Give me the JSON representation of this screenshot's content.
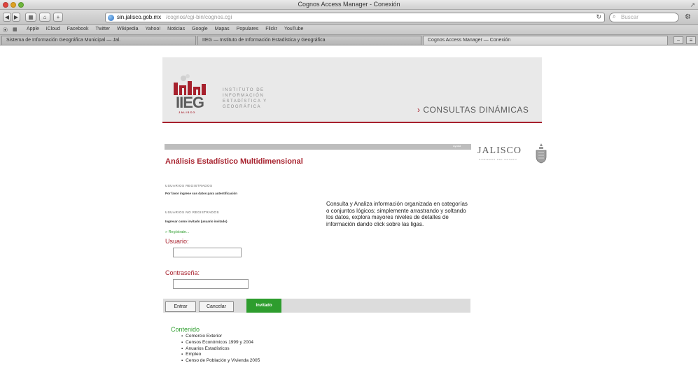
{
  "window": {
    "title": "Cognos Access Manager - Conexión",
    "address_host": "sin.jalisco.gob.mx",
    "address_path": "/cognos/cgi-bin/cognos.cgi",
    "search_placeholder": "Buscar"
  },
  "bookmarks": {
    "items": [
      "Apple",
      "iCloud",
      "Facebook",
      "Twitter",
      "Wikipedia",
      "Yahoo!",
      "Noticias",
      "Google",
      "Mapas",
      "Populares",
      "Flickr",
      "YouTube"
    ]
  },
  "tabs": [
    {
      "label": "Sistema de Información Geográfica Municipal — Jal.",
      "active": false
    },
    {
      "label": "IIEG — Instituto de Información Estadística y Geográfica",
      "active": false
    },
    {
      "label": "Cognos Access Manager — Conexión",
      "active": true
    }
  ],
  "banner": {
    "logo_word": "IIEG",
    "logo_sub": "JALISCO",
    "institute_name": "INSTITUTO DE INFORMACIÓN ESTADÍSTICA Y GEOGRÁFICA",
    "section_arrow": "›",
    "section_title": "CONSULTAS DINÁMICAS"
  },
  "header_strip": {
    "tag": "Ayuda",
    "brand": "JALISCO",
    "brand_sub": "GOBIERNO DEL ESTADO"
  },
  "login": {
    "heading": "Análisis Estadístico Multidimensional",
    "registered_label": "USUARIOS REGISTRADOS",
    "registered_text": "Por favor ingrese sus datos para autentificación",
    "unregistered_label": "USUARIOS NO REGISTRADOS",
    "unregistered_text": "Ingresar como invitado (usuario invitado)",
    "register_link": "» Regístrate...",
    "user_label": "Usuario:",
    "user_value": "",
    "password_label": "Contraseña:",
    "password_value": "",
    "description": "Consulta y Analiza información organizada en categorías o conjuntos lógicos; simplemente arrastrando y soltando los datos, explora mayores niveles de detalles de información dando click sobre las ligas.",
    "enter_button": "Entrar",
    "cancel_button": "Cancelar",
    "guest_button": "Invitado"
  },
  "contenido": {
    "title": "Contenido",
    "items": [
      "Comercio Exterior",
      "Censos Económicos 1999 y 2004",
      "Anuarios Estadísticos",
      "Empleo",
      "Censo de Población y Vivienda 2005"
    ]
  },
  "colors": {
    "brand_red": "#a7212d",
    "accent_green": "#2e9d2e",
    "banner_gray": "#e9e9e9"
  }
}
